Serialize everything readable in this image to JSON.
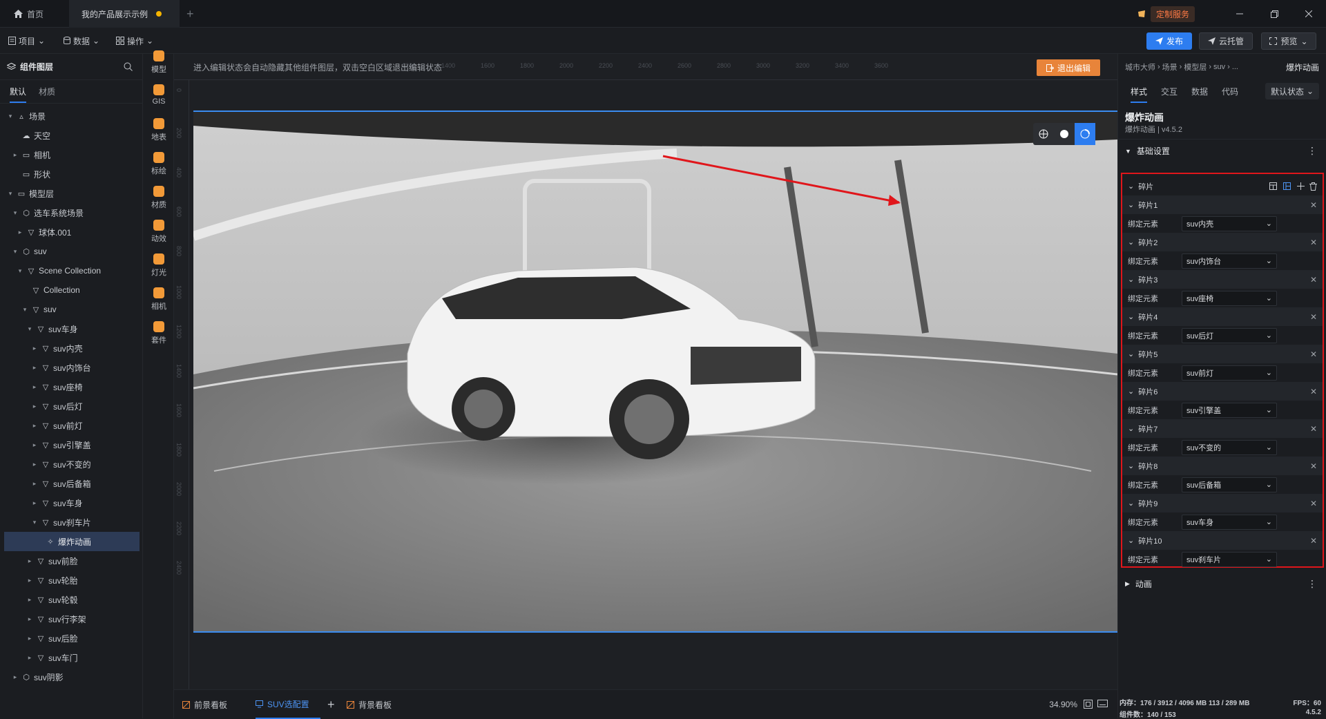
{
  "tabs": {
    "home": "首页",
    "active": "我的产品展示示例",
    "add": "+"
  },
  "top_right": {
    "custom_service": "定制服务"
  },
  "menu": {
    "project": "项目",
    "data": "数据",
    "operate": "操作"
  },
  "actions": {
    "publish": "发布",
    "cloud": "云托管",
    "preview": "预览"
  },
  "left_panel": {
    "title": "组件图层",
    "tabs": [
      "默认",
      "材质"
    ],
    "tree": [
      {
        "label": "场景",
        "depth": 0,
        "caret": "▾",
        "icon": "▵"
      },
      {
        "label": "天空",
        "depth": 1,
        "caret": "",
        "icon": "☁"
      },
      {
        "label": "相机",
        "depth": 1,
        "caret": "▸",
        "icon": "▭"
      },
      {
        "label": "形状",
        "depth": 1,
        "caret": "",
        "icon": "▭"
      },
      {
        "label": "模型层",
        "depth": 0,
        "caret": "▾",
        "icon": "▭"
      },
      {
        "label": "选车系统场景",
        "depth": 1,
        "caret": "▾",
        "icon": "⬡"
      },
      {
        "label": "球体.001",
        "depth": 2,
        "caret": "▸",
        "icon": "▽"
      },
      {
        "label": "suv",
        "depth": 1,
        "caret": "▾",
        "icon": "⬡"
      },
      {
        "label": "Scene Collection",
        "depth": 2,
        "caret": "▾",
        "icon": "▽"
      },
      {
        "label": "Collection",
        "depth": 3,
        "caret": "",
        "icon": "▽"
      },
      {
        "label": "suv",
        "depth": 3,
        "caret": "▾",
        "icon": "▽"
      },
      {
        "label": "suv车身",
        "depth": 4,
        "caret": "▾",
        "icon": "▽"
      },
      {
        "label": "suv内壳",
        "depth": 5,
        "caret": "▸",
        "icon": "▽"
      },
      {
        "label": "suv内饰台",
        "depth": 5,
        "caret": "▸",
        "icon": "▽"
      },
      {
        "label": "suv座椅",
        "depth": 5,
        "caret": "▸",
        "icon": "▽"
      },
      {
        "label": "suv后灯",
        "depth": 5,
        "caret": "▸",
        "icon": "▽"
      },
      {
        "label": "suv前灯",
        "depth": 5,
        "caret": "▸",
        "icon": "▽"
      },
      {
        "label": "suv引擎盖",
        "depth": 5,
        "caret": "▸",
        "icon": "▽"
      },
      {
        "label": "suv不变的",
        "depth": 5,
        "caret": "▸",
        "icon": "▽"
      },
      {
        "label": "suv后备箱",
        "depth": 5,
        "caret": "▸",
        "icon": "▽"
      },
      {
        "label": "suv车身",
        "depth": 5,
        "caret": "▸",
        "icon": "▽"
      },
      {
        "label": "suv刹车片",
        "depth": 5,
        "caret": "▾",
        "icon": "▽"
      },
      {
        "label": "爆炸动画",
        "depth": 6,
        "caret": "",
        "icon": "✧",
        "selected": true
      },
      {
        "label": "suv前脸",
        "depth": 4,
        "caret": "▸",
        "icon": "▽"
      },
      {
        "label": "suv轮胎",
        "depth": 4,
        "caret": "▸",
        "icon": "▽"
      },
      {
        "label": "suv轮毂",
        "depth": 4,
        "caret": "▸",
        "icon": "▽"
      },
      {
        "label": "suv行李架",
        "depth": 4,
        "caret": "▸",
        "icon": "▽"
      },
      {
        "label": "suv后脸",
        "depth": 4,
        "caret": "▸",
        "icon": "▽"
      },
      {
        "label": "suv车门",
        "depth": 4,
        "caret": "▸",
        "icon": "▽"
      },
      {
        "label": "suv阴影",
        "depth": 1,
        "caret": "▸",
        "icon": "⬡"
      }
    ]
  },
  "icon_column": [
    {
      "label": "模型",
      "icon": "model-icon",
      "color": "#f29a38"
    },
    {
      "label": "GIS",
      "icon": "gis-icon",
      "color": "#f29a38"
    },
    {
      "label": "地表",
      "icon": "terrain-icon",
      "color": "#f29a38"
    },
    {
      "label": "标绘",
      "icon": "marker-icon",
      "color": "#f29a38"
    },
    {
      "label": "材质",
      "icon": "material-icon",
      "color": "#f29a38"
    },
    {
      "label": "动效",
      "icon": "effect-icon",
      "color": "#f29a38"
    },
    {
      "label": "灯光",
      "icon": "light-icon",
      "color": "#f29a38"
    },
    {
      "label": "相机",
      "icon": "camera-icon",
      "color": "#f29a38"
    },
    {
      "label": "套件",
      "icon": "kit-icon",
      "color": "#f29a38"
    }
  ],
  "canvas": {
    "hint": "进入编辑状态会自动隐藏其他组件图层，双击空白区域退出编辑状态",
    "exit_edit": "退出编辑",
    "ruler_top": [
      "1200",
      "1400",
      "1600",
      "1800",
      "2000",
      "2200",
      "2400",
      "2600",
      "2800",
      "3000",
      "3200",
      "3400",
      "3600"
    ],
    "ruler_left": [
      "0",
      "200",
      "400",
      "600",
      "800",
      "1000",
      "1200",
      "1400",
      "1600",
      "1800",
      "2000",
      "2200",
      "2400"
    ]
  },
  "bottom": {
    "tabs": [
      "前景看板",
      "SUV选配置",
      "背景看板"
    ],
    "add": "+",
    "zoom": "34.90%"
  },
  "right_panel": {
    "crumb": [
      "城市大师",
      "场景",
      "模型层",
      "suv",
      "..."
    ],
    "title": "爆炸动画",
    "tabs": [
      "样式",
      "交互",
      "数据",
      "代码"
    ],
    "state": "默认状态",
    "component_name": "爆炸动画",
    "component_version": "爆炸动画 | v4.5.2",
    "section_basic": "基础设置",
    "fragments_label": "碎片",
    "bind_label": "绑定元素",
    "fragments": [
      {
        "name": "碎片1",
        "value": "suv内壳"
      },
      {
        "name": "碎片2",
        "value": "suv内饰台"
      },
      {
        "name": "碎片3",
        "value": "suv座椅"
      },
      {
        "name": "碎片4",
        "value": "suv后灯"
      },
      {
        "name": "碎片5",
        "value": "suv前灯"
      },
      {
        "name": "碎片6",
        "value": "suv引擎盖"
      },
      {
        "name": "碎片7",
        "value": "suv不变的"
      },
      {
        "name": "碎片8",
        "value": "suv后备箱"
      },
      {
        "name": "碎片9",
        "value": "suv车身"
      },
      {
        "name": "碎片10",
        "value": "suv刹车片"
      }
    ],
    "section_anim": "动画",
    "footer": {
      "memory": "内存：176 / 3912 / 4096 MB 113 / 289 MB",
      "fps": "FPS：60",
      "components": "组件数：140 / 153",
      "version": "4.5.2"
    }
  },
  "colors": {
    "accent": "#2d7df0",
    "highlight": "#e0161b",
    "orange": "#e8843a"
  }
}
